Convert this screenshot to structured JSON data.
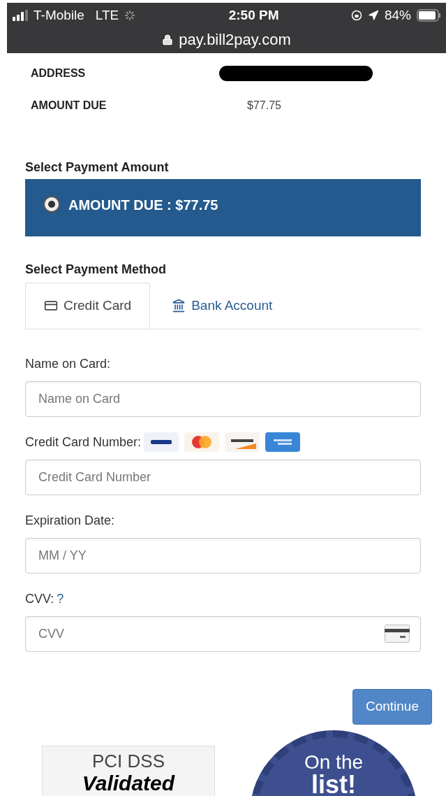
{
  "status_bar": {
    "carrier": "T-Mobile",
    "network": "LTE",
    "time": "2:50 PM",
    "battery": "84%"
  },
  "url_bar": {
    "url": "pay.bill2pay.com"
  },
  "summary": [
    {
      "label": "ADDRESS",
      "kind": "redacted"
    },
    {
      "label": "AMOUNT DUE",
      "kind": "text",
      "value": "$77.75"
    }
  ],
  "payment_amount": {
    "heading": "Select Payment Amount",
    "options": [
      {
        "label": "AMOUNT DUE : $77.75",
        "selected": true
      }
    ]
  },
  "payment_method": {
    "heading": "Select Payment Method",
    "tabs": [
      {
        "label": "Credit Card",
        "kind": "card",
        "selected": true
      },
      {
        "label": "Bank Account",
        "kind": "bank",
        "selected": false
      }
    ]
  },
  "fields": [
    {
      "label": "Name on Card:",
      "placeholder": "Name on Card",
      "kind": "name"
    },
    {
      "label": "Credit Card Number:",
      "placeholder": "Credit Card Number",
      "kind": "number"
    },
    {
      "label": "Expiration Date:",
      "placeholder": "MM / YY",
      "kind": "expiry"
    },
    {
      "label": "CVV:",
      "help": "?",
      "placeholder": "CVV",
      "kind": "cvv"
    }
  ],
  "continue_button": "Continue",
  "badges": {
    "pci": {
      "line1": "PCI DSS",
      "line2": "Validated"
    },
    "seal": {
      "line1": "On the",
      "line2": "list!"
    }
  }
}
